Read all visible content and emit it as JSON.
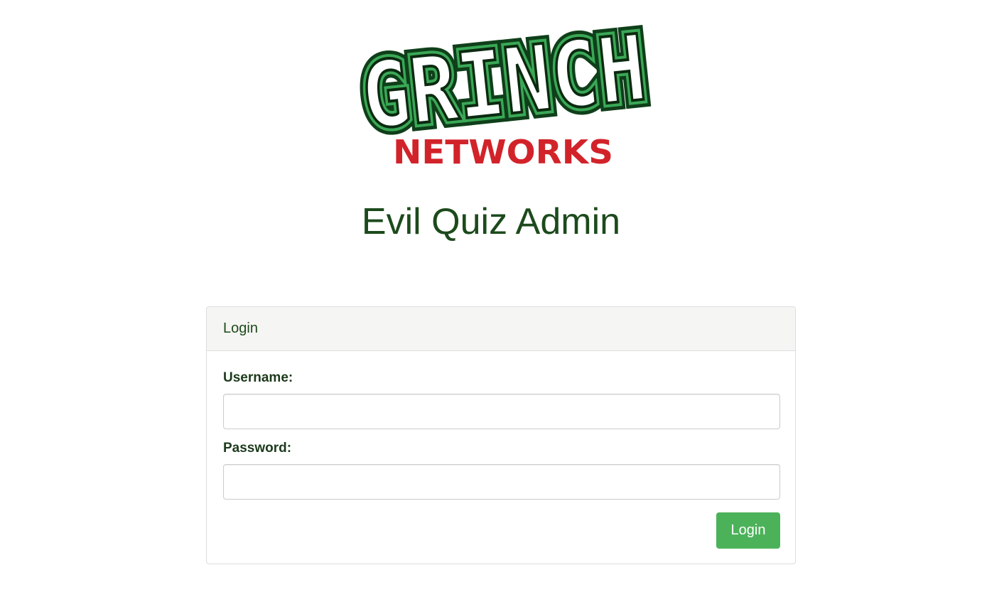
{
  "logo": {
    "name": "GRINCH",
    "subtitle": "NETWORKS"
  },
  "page": {
    "title": "Evil Quiz Admin"
  },
  "login_panel": {
    "heading": "Login",
    "username_label": "Username:",
    "username_value": "",
    "password_label": "Password:",
    "password_value": "",
    "submit_label": "Login"
  },
  "colors": {
    "title": "#1c4a1c",
    "logo_green": "#3aa856",
    "logo_red": "#d2232a",
    "button": "#4cb25a"
  }
}
